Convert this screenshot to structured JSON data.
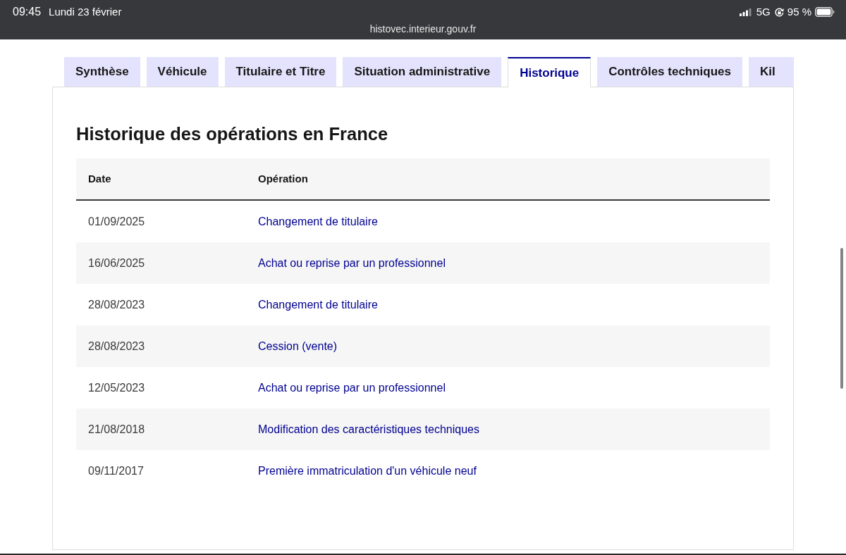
{
  "status_bar": {
    "time": "09:45",
    "date": "Lundi 23 février",
    "network": "5G",
    "battery": "95 %"
  },
  "address_bar": {
    "url": "histovec.interieur.gouv.fr"
  },
  "tabs": [
    {
      "label": "Synthèse",
      "selected": false
    },
    {
      "label": "Véhicule",
      "selected": false
    },
    {
      "label": "Titulaire et Titre",
      "selected": false
    },
    {
      "label": "Situation administrative",
      "selected": false
    },
    {
      "label": "Historique",
      "selected": true
    },
    {
      "label": "Contrôles techniques",
      "selected": false
    },
    {
      "label": "Kil",
      "selected": false
    }
  ],
  "section": {
    "title": "Historique des opérations en France",
    "table": {
      "columns": [
        "Date",
        "Opération"
      ],
      "rows": [
        {
          "date": "01/09/2025",
          "operation": "Changement de titulaire"
        },
        {
          "date": "16/06/2025",
          "operation": "Achat ou reprise par un professionnel"
        },
        {
          "date": "28/08/2023",
          "operation": "Changement de titulaire"
        },
        {
          "date": "28/08/2023",
          "operation": "Cession (vente)"
        },
        {
          "date": "12/05/2023",
          "operation": "Achat ou reprise par un professionnel"
        },
        {
          "date": "21/08/2018",
          "operation": "Modification des caractéristiques techniques"
        },
        {
          "date": "09/11/2017",
          "operation": "Première immatriculation d'un véhicule neuf"
        }
      ]
    }
  }
}
